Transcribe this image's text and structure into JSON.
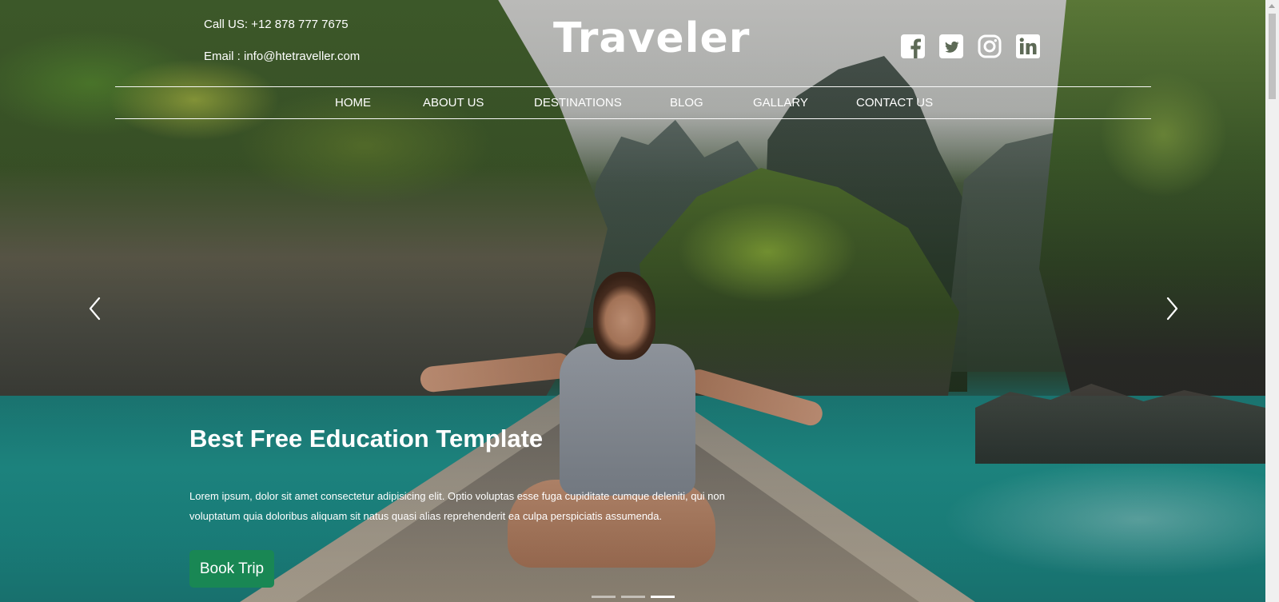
{
  "header": {
    "call": "Call US: +12 878 777 7675",
    "email": "Email : info@htetraveller.com",
    "brand": "Traveler",
    "social": [
      "facebook-icon",
      "twitter-icon",
      "instagram-icon",
      "linkedin-icon"
    ]
  },
  "nav": {
    "items": [
      {
        "label": "HOME"
      },
      {
        "label": "ABOUT US"
      },
      {
        "label": "DESTINATIONS"
      },
      {
        "label": "BLOG"
      },
      {
        "label": "GALLARY"
      },
      {
        "label": "CONTACT US"
      }
    ]
  },
  "hero": {
    "title": "Best Free Education Template",
    "text": "Lorem ipsum, dolor sit amet consectetur adipisicing elit. Optio voluptas esse fuga cupiditate cumque deleniti, qui non voluptatum quia doloribus aliquam sit natus quasi alias reprehenderit ea culpa perspiciatis assumenda.",
    "button": "Book Trip",
    "button_color": "#198754",
    "slides": 3,
    "active_slide": 3
  }
}
